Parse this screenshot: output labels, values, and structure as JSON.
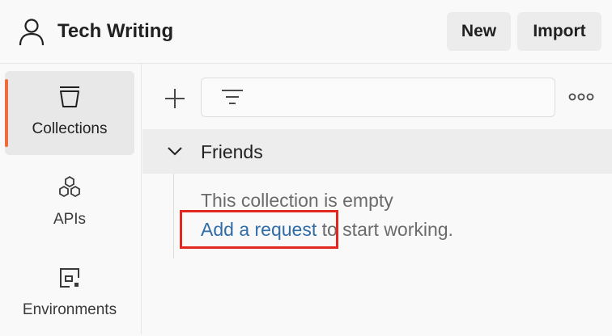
{
  "header": {
    "workspace_icon": "user-icon",
    "workspace_title": "Tech Writing",
    "new_label": "New",
    "import_label": "Import"
  },
  "sidebar": {
    "items": [
      {
        "label": "Collections",
        "icon": "collections-icon",
        "active": true
      },
      {
        "label": "APIs",
        "icon": "apis-icon",
        "active": false
      },
      {
        "label": "Environments",
        "icon": "environments-icon",
        "active": false
      }
    ]
  },
  "toolbar": {
    "add_icon": "plus-icon",
    "filter_icon": "filter-icon",
    "more_icon": "more-options-icon"
  },
  "collection": {
    "name": "Friends",
    "expanded": true,
    "empty_message": "This collection is empty",
    "add_request_link": "Add a request",
    "add_request_suffix": " to start working."
  },
  "colors": {
    "accent": "#ef6c3b",
    "link": "#2f6ca8",
    "highlight": "#e0281f"
  }
}
